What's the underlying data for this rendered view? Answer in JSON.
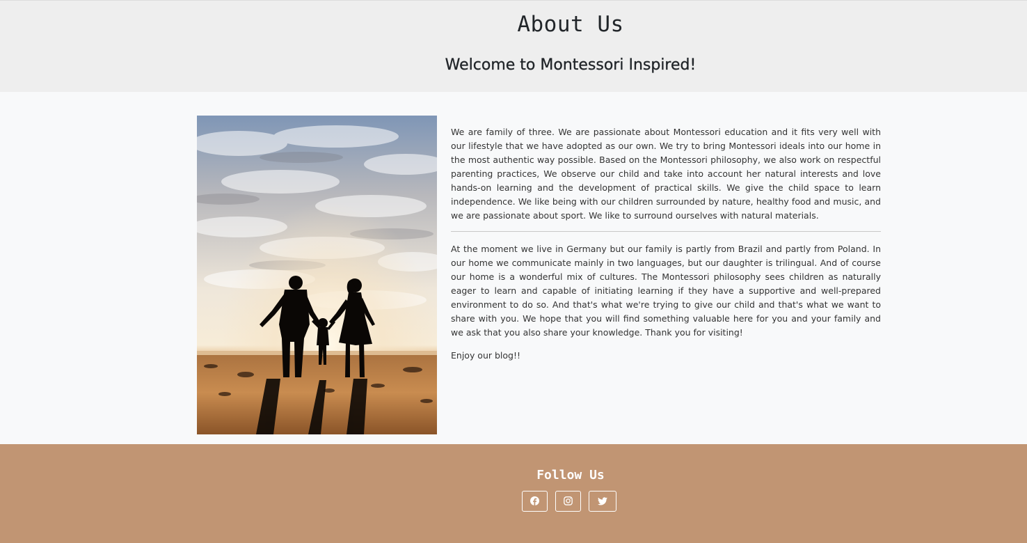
{
  "header": {
    "title": "About Us",
    "subtitle": "Welcome to Montessori Inspired!"
  },
  "main": {
    "image": {
      "subject": "family-silhouette-on-beach-at-sunset"
    },
    "paragraphs": [
      "We are family of three. We are passionate about Montessori education and it fits very well with our lifestyle that we have adopted as our own. We try to bring Montessori ideals into our home in the most authentic way possible. Based on the Montessori philosophy, we also work on respectful parenting practices, We observe our child and take into account her natural interests and love hands-on learning and the development of practical skills. We give the child space to learn independence. We like being with our children surrounded by nature, healthy food and music, and we are passionate about sport. We like to surround ourselves with natural materials.",
      "At the moment we live in Germany but our family is partly from Brazil and partly from Poland. In our home we communicate mainly in two languages, but our daughter is trilingual. And of course our home is a wonderful mix of cultures. The Montessori philosophy sees children as naturally eager to learn and capable of initiating learning if they have a supportive and well-prepared environment to do so. And that's what we're trying to give our child and that's what we want to share with you. We hope that you will find something valuable here for you and your family and we ask that you also share your knowledge. Thank you for visiting!",
      "Enjoy our blog!!"
    ]
  },
  "footer": {
    "title": "Follow Us",
    "social": [
      {
        "icon": "facebook-icon"
      },
      {
        "icon": "instagram-icon"
      },
      {
        "icon": "twitter-icon"
      }
    ]
  },
  "colors": {
    "header_bg": "#eeeeee",
    "main_bg": "#f8f9fa",
    "footer_bg": "#c19573",
    "text": "#212529"
  }
}
